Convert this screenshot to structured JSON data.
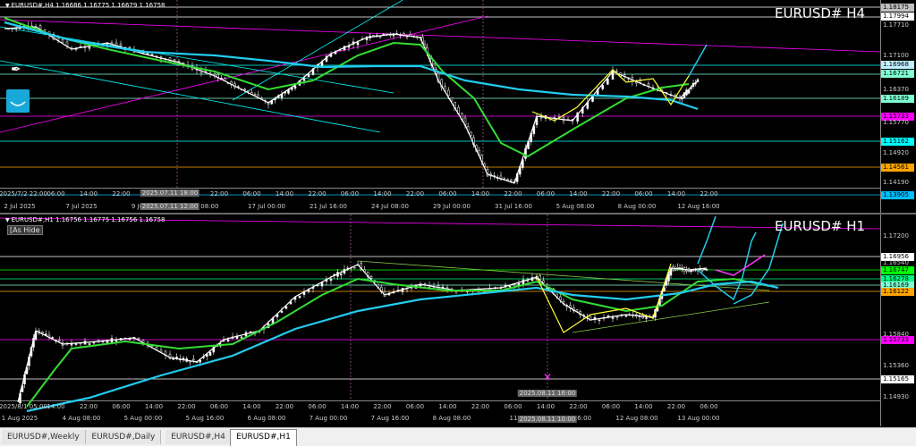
{
  "h4": {
    "header": "EURUSD#,H4  1.16686 1.16775 1.16679 1.16758",
    "big_title": "EURUSD#  H4",
    "price_labels": [
      {
        "text": "1.18175",
        "bg": "#c0c0c0",
        "fg": "#000"
      },
      {
        "text": "1.17994",
        "bg": "#ffffff",
        "fg": "#000"
      },
      {
        "text": "1.16968",
        "bg": "#bfefff",
        "fg": "#000"
      },
      {
        "text": "1.16721",
        "bg": "#7fffd4",
        "fg": "#000"
      },
      {
        "text": "1.16189",
        "bg": "#7fffd4",
        "fg": "#000"
      },
      {
        "text": "1.15733",
        "bg": "#ff00ff",
        "fg": "#000"
      },
      {
        "text": "1.15162",
        "bg": "#00ffff",
        "fg": "#000"
      },
      {
        "text": "1.14561",
        "bg": "#ffa500",
        "fg": "#000"
      },
      {
        "text": "1.13905",
        "bg": "#00bfff",
        "fg": "#000"
      }
    ],
    "price_text": [
      "1.17710",
      "1.17100",
      "1.16370",
      "1.15770",
      "1.14920",
      "1.14190"
    ],
    "time_labels": [
      "2025/7/2 22:00",
      "06:00",
      "14:00",
      "22:00",
      "06:00",
      "14:00",
      "22:00",
      "06:00",
      "14:00",
      "22:00",
      "06:00",
      "14:00",
      "22:00",
      "06:00",
      "14:00",
      "22:00",
      "06:00",
      "14:00",
      "22:00",
      "06:00",
      "14:00",
      "22:00"
    ],
    "date_labels": [
      "2 Jul 2025",
      "7 Jul 2025",
      "9 Jul 20",
      "Jul 08:00",
      "17 Jul 00:00",
      "21 Jul 16:00",
      "24 Jul 08:00",
      "29 Jul 00:00",
      "31 Jul 16:00",
      "5 Aug 08:00",
      "8 Aug 00:00",
      "12 Aug 16:00"
    ],
    "crosshair_top": "2025.07.11 18:00",
    "crosshair_bottom": "2025.07.11 12:00"
  },
  "h1": {
    "header": "EURUSD#,H1  1.16756 1.16775 1.16756 1.16758",
    "hide_label": "[As Hide",
    "big_title": "EURUSD#  H1",
    "price_labels": [
      {
        "text": "1.16956",
        "bg": "#ffffff",
        "fg": "#000"
      },
      {
        "text": "1.16747",
        "bg": "#00ff00",
        "fg": "#000"
      },
      {
        "text": "1.16278",
        "bg": "#00ff7f",
        "fg": "#000"
      },
      {
        "text": "1.16169",
        "bg": "#7fffd4",
        "fg": "#000"
      },
      {
        "text": "1.16122",
        "bg": "#ffa500",
        "fg": "#000"
      },
      {
        "text": "1.15733",
        "bg": "#ff00ff",
        "fg": "#000"
      },
      {
        "text": "1.15165",
        "bg": "#ffffff",
        "fg": "#000"
      }
    ],
    "price_text": [
      "1.17200",
      "1.16540",
      "1.15840",
      "1.15360",
      "1.14930"
    ],
    "time_labels": [
      "2025/8/1 05:00",
      "14:00",
      "22:00",
      "06:00",
      "14:00",
      "22:00",
      "06:00",
      "14:00",
      "22:00",
      "06:00",
      "14:00",
      "22:00",
      "06:00",
      "14:00",
      "22:00",
      "06:00",
      "14:00",
      "22:00",
      "06:00",
      "14:00",
      "22:00",
      "06:00"
    ],
    "date_labels": [
      "1 Aug 2025",
      "4 Aug 08:00",
      "5 Aug 00:00",
      "5 Aug 16:00",
      "6 Aug 08:00",
      "7 Aug 00:00",
      "7 Aug 16:00",
      "8 Aug 08:00",
      "11",
      "Aug 16:00",
      "12 Aug 08:00",
      "13 Aug 00:00"
    ],
    "crosshair_top": "2025.08.11 16:00",
    "crosshair_bottom": "2025.08.11 10:00"
  },
  "tabs": [
    "EURUSD#,Weekly",
    "EURUSD#,Daily",
    "EURUSD#,H4",
    "EURUSD#,H1"
  ],
  "active_tab": 3
}
